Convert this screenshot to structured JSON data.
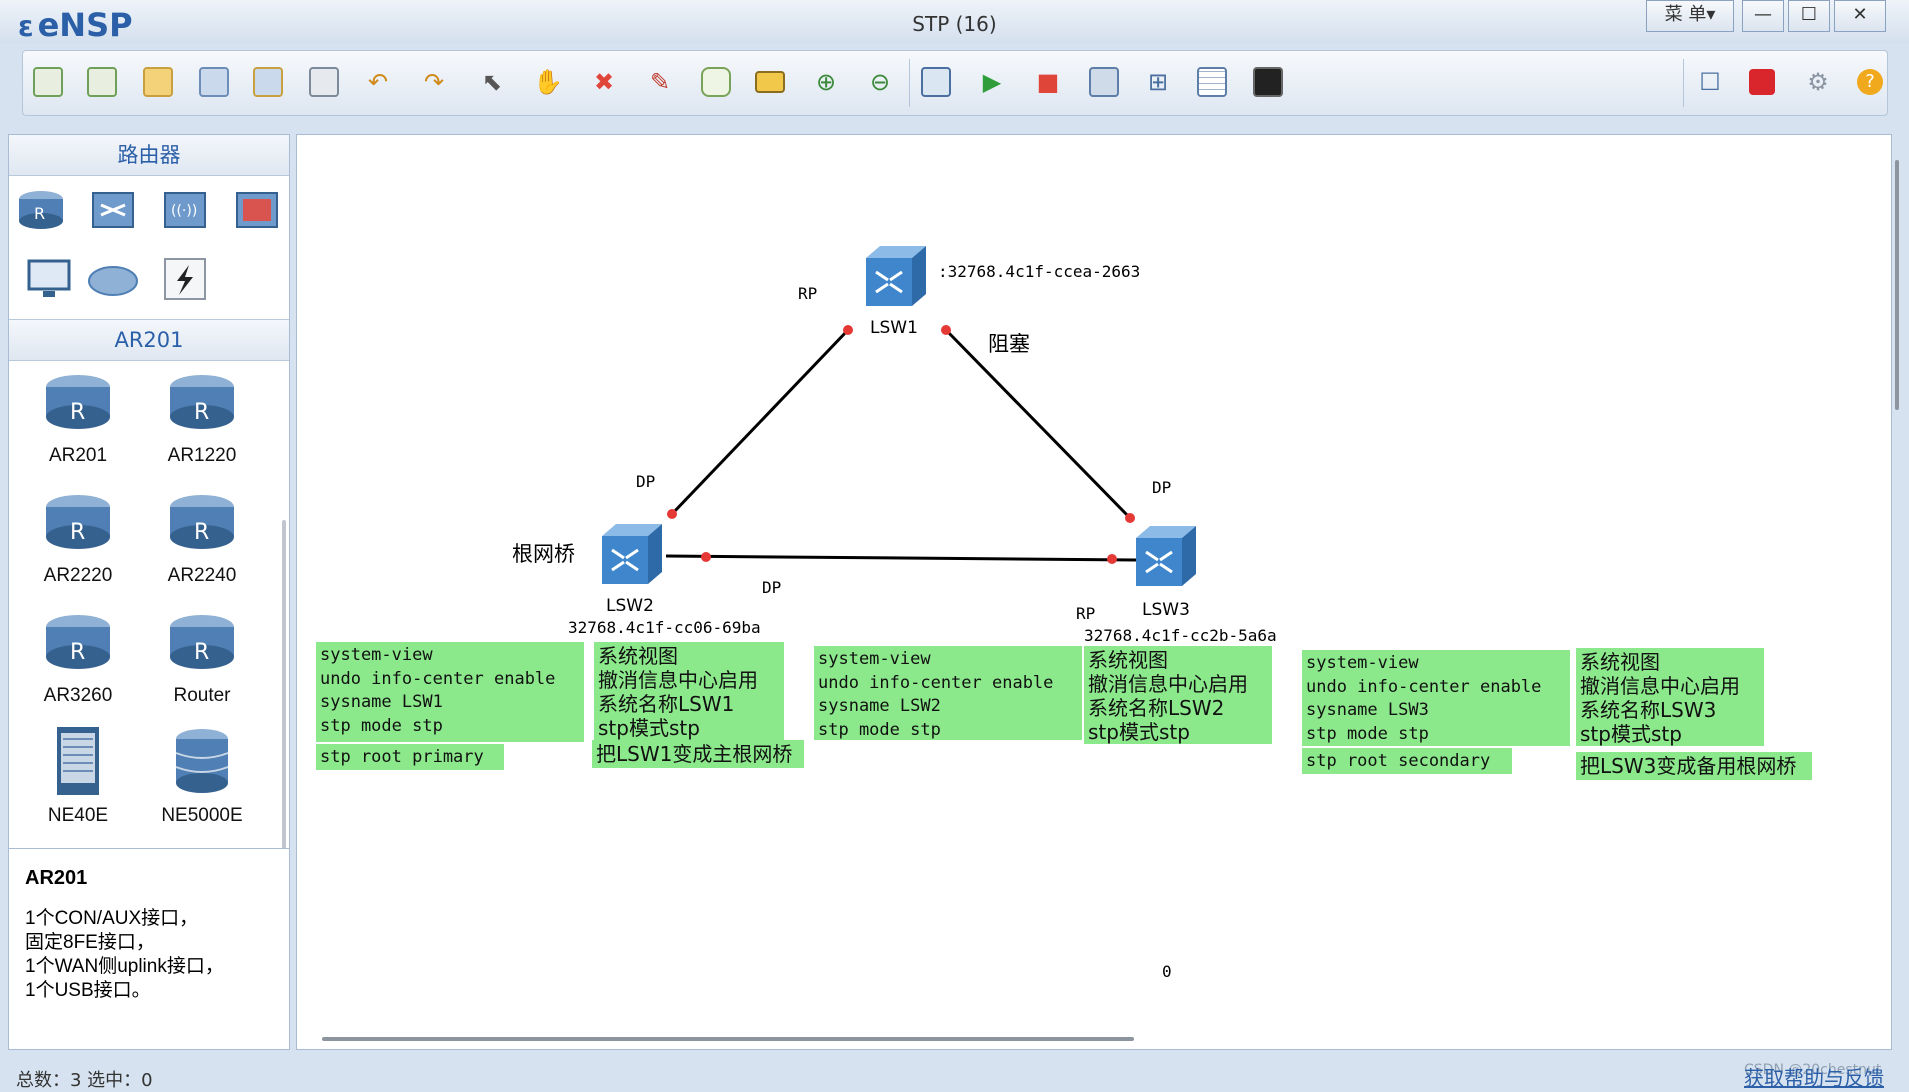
{
  "window": {
    "app_name": "eNSP",
    "title": "STP (16)",
    "menu_label": "菜 单▾",
    "minimize": "—",
    "maximize": "☐",
    "close": "✕"
  },
  "left_panel": {
    "category_title": "路由器",
    "subcategory_title": "AR201",
    "devices": [
      {
        "label": "AR201"
      },
      {
        "label": "AR1220"
      },
      {
        "label": "AR2220"
      },
      {
        "label": "AR2240"
      },
      {
        "label": "AR3260"
      },
      {
        "label": "Router"
      },
      {
        "label": "NE40E"
      },
      {
        "label": "NE5000E"
      }
    ],
    "description": {
      "title": "AR201",
      "lines": [
        "1个CON/AUX接口，",
        "固定8FE接口，",
        "1个WAN侧uplink接口，",
        "1个USB接口。"
      ]
    }
  },
  "topology": {
    "lsw1": {
      "name": "LSW1",
      "bridge_id": ":32768.4c1f-ccea-2663"
    },
    "lsw2": {
      "name": "LSW2",
      "bridge_id": "32768.4c1f-cc06-69ba",
      "tag": "根网桥"
    },
    "lsw3": {
      "name": "LSW3",
      "bridge_id": "32768.4c1f-cc2b-5a6a"
    },
    "port_labels": {
      "lsw1_left": "RP",
      "lsw1_right_blocked": "阻塞",
      "lsw2_top": "DP",
      "lsw2_right": "DP",
      "lsw3_top": "DP",
      "lsw3_left": "RP"
    },
    "bottom_marker": "0"
  },
  "notes": {
    "lsw1_cmds": [
      "system-view",
      "undo info-center enable",
      "sysname LSW1",
      "stp mode stp"
    ],
    "lsw1_cmd_extra": "stp root primary",
    "lsw1_cn": [
      "系统视图",
      "撤消信息中心启用",
      "系统名称LSW1",
      "stp模式stp"
    ],
    "lsw1_cn_extra": "把LSW1变成主根网桥",
    "lsw2_cmds": [
      "system-view",
      "undo info-center enable",
      "sysname LSW2",
      "stp mode stp"
    ],
    "lsw2_cn": [
      "系统视图",
      "撤消信息中心启用",
      "系统名称LSW2",
      "stp模式stp"
    ],
    "lsw3_cmds": [
      "system-view",
      "undo info-center enable",
      "sysname LSW3",
      "stp mode stp"
    ],
    "lsw3_cmd_extra": "stp root secondary",
    "lsw3_cn": [
      "系统视图",
      "撤消信息中心启用",
      "系统名称LSW3",
      "stp模式stp"
    ],
    "lsw3_cn_extra": "把LSW3变成备用根网桥"
  },
  "status": {
    "summary": "总数：3  选中：0",
    "help_link": "获取帮助与反馈",
    "watermark": "CSDN @20chestnut"
  },
  "colors": {
    "note_bg": "#8be88b",
    "port_dot": "#e53935",
    "switch_blue": "#3f86cc",
    "brand": "#2b5fa8"
  }
}
